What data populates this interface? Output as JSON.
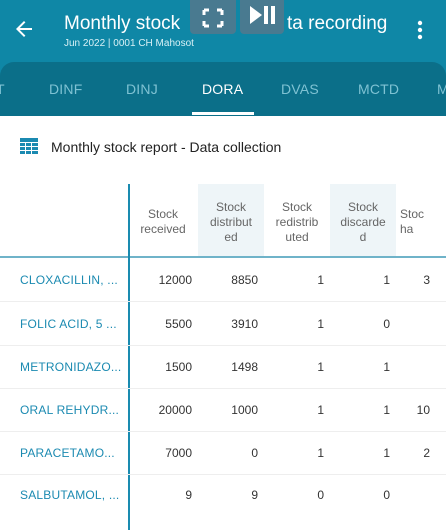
{
  "header": {
    "title_left": "Monthly stock",
    "title_right": "ta recording",
    "subtitle": "Jun 2022 | 0001 CH Mahosot"
  },
  "overlay": {
    "fullscreen_symbol": "⛶",
    "playpause_symbol": "⏯"
  },
  "tabs": [
    {
      "label": "T"
    },
    {
      "label": "DINF"
    },
    {
      "label": "DINJ"
    },
    {
      "label": "DORA"
    },
    {
      "label": "DVAS"
    },
    {
      "label": "MCTD"
    },
    {
      "label": "M"
    }
  ],
  "section": {
    "title": "Monthly stock report - Data collection"
  },
  "table": {
    "columns": [
      "Stock\nreceived",
      "Stock\ndistribut\ned",
      "Stock\nredistrib\nuted",
      "Stock\ndiscarde\nd",
      "Stoc\nha"
    ],
    "rows": [
      {
        "label": "CLOXACILLIN, ...",
        "values": [
          "12000",
          "8850",
          "1",
          "1",
          "3"
        ]
      },
      {
        "label": "FOLIC ACID, 5 ...",
        "values": [
          "5500",
          "3910",
          "1",
          "0",
          ""
        ]
      },
      {
        "label": "METRONIDAZO...",
        "values": [
          "1500",
          "1498",
          "1",
          "1",
          ""
        ]
      },
      {
        "label": "ORAL REHYDR...",
        "values": [
          "20000",
          "1000",
          "1",
          "1",
          "10"
        ]
      },
      {
        "label": "PARACETAMO...",
        "values": [
          "7000",
          "0",
          "1",
          "1",
          "2"
        ]
      },
      {
        "label": "SALBUTAMOL, ...",
        "values": [
          "9",
          "9",
          "0",
          "0",
          ""
        ]
      }
    ]
  },
  "colors": {
    "appbar": "#0f87a6",
    "tabbar": "#0b6f89",
    "accent": "#1b8ab1",
    "header_shade": "#eef5f8"
  },
  "icons": {
    "back": "arrow-left-icon",
    "more": "more-vert-icon",
    "section": "table-icon",
    "fullscreen": "fullscreen-icon",
    "playpause": "play-pause-icon"
  }
}
